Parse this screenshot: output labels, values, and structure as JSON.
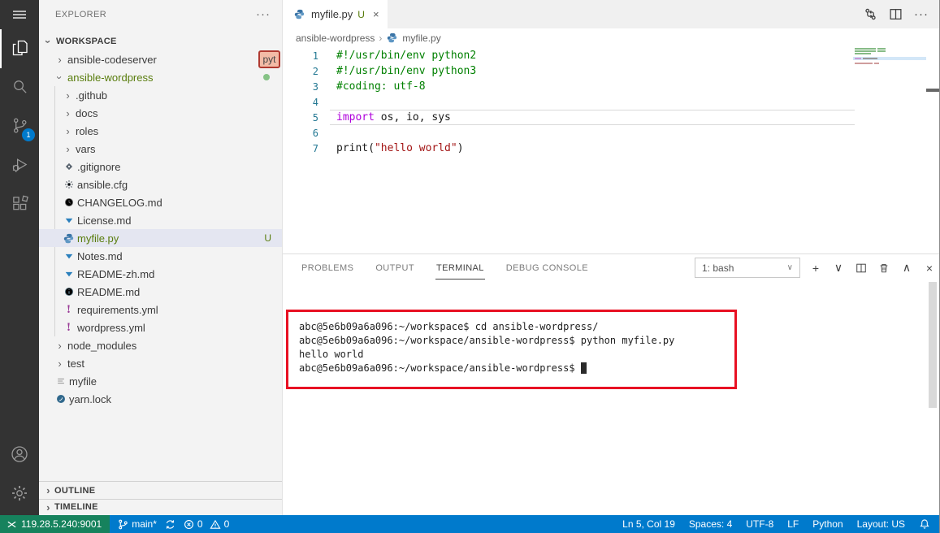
{
  "colors": {
    "accent_blue": "#007acc",
    "remote_green": "#16825d",
    "annotation_red": "#e81123",
    "untracked_green": "#587c0c",
    "selection_bg": "#e4e6f1",
    "activity_bar_bg": "#333333",
    "sidebar_bg": "#f3f3f3"
  },
  "activity_bar": {
    "items": [
      {
        "id": "menu",
        "icon": "menu-icon"
      },
      {
        "id": "explorer",
        "icon": "files-icon",
        "active": true
      },
      {
        "id": "search",
        "icon": "search-icon"
      },
      {
        "id": "source-control",
        "icon": "source-control-icon",
        "badge": "1"
      },
      {
        "id": "run-debug",
        "icon": "debug-icon"
      },
      {
        "id": "extensions",
        "icon": "extensions-icon"
      }
    ],
    "bottom_items": [
      {
        "id": "accounts",
        "icon": "account-icon"
      },
      {
        "id": "settings",
        "icon": "gear-icon"
      }
    ]
  },
  "sidebar": {
    "title": "EXPLORER",
    "more_label": "···",
    "root_label": "WORKSPACE",
    "hover_badge": "pyt",
    "tree": [
      {
        "label": "ansible-codeserver",
        "level": 1,
        "kind": "folder",
        "expanded": false
      },
      {
        "label": "ansible-wordpress",
        "level": 1,
        "kind": "folder",
        "expanded": true,
        "git": "untracked",
        "dot": true
      },
      {
        "label": ".github",
        "level": 2,
        "kind": "folder",
        "expanded": false
      },
      {
        "label": "docs",
        "level": 2,
        "kind": "folder",
        "expanded": false
      },
      {
        "label": "roles",
        "level": 2,
        "kind": "folder",
        "expanded": false
      },
      {
        "label": "vars",
        "level": 2,
        "kind": "folder",
        "expanded": false
      },
      {
        "label": ".gitignore",
        "level": 2,
        "kind": "file",
        "icon": "git-icon"
      },
      {
        "label": "ansible.cfg",
        "level": 2,
        "kind": "file",
        "icon": "gear-file-icon"
      },
      {
        "label": "CHANGELOG.md",
        "level": 2,
        "kind": "file",
        "icon": "clock-icon"
      },
      {
        "label": "License.md",
        "level": 2,
        "kind": "file",
        "icon": "markdown-down-icon"
      },
      {
        "label": "myfile.py",
        "level": 2,
        "kind": "file",
        "icon": "python-icon",
        "selected": true,
        "git": "untracked",
        "badge": "U"
      },
      {
        "label": "Notes.md",
        "level": 2,
        "kind": "file",
        "icon": "markdown-down-icon"
      },
      {
        "label": "README-zh.md",
        "level": 2,
        "kind": "file",
        "icon": "markdown-down-icon"
      },
      {
        "label": "README.md",
        "level": 2,
        "kind": "file",
        "icon": "info-icon"
      },
      {
        "label": "requirements.yml",
        "level": 2,
        "kind": "file",
        "icon": "exclamation-icon"
      },
      {
        "label": "wordpress.yml",
        "level": 2,
        "kind": "file",
        "icon": "exclamation-icon"
      },
      {
        "label": "node_modules",
        "level": 1,
        "kind": "folder",
        "expanded": false
      },
      {
        "label": "test",
        "level": 1,
        "kind": "folder",
        "expanded": false
      },
      {
        "label": "myfile",
        "level": 1,
        "kind": "file",
        "icon": "list-icon"
      },
      {
        "label": "yarn.lock",
        "level": 1,
        "kind": "file",
        "icon": "yarn-icon"
      }
    ],
    "bottom_sections": [
      {
        "label": "OUTLINE"
      },
      {
        "label": "TIMELINE"
      }
    ]
  },
  "editor": {
    "tab": {
      "label": "myfile.py",
      "git_badge": "U",
      "close_label": "×",
      "icon": "python-icon"
    },
    "actions": [
      {
        "id": "open-changes",
        "icon": "open-changes-icon"
      },
      {
        "id": "split-editor",
        "icon": "split-editor-icon"
      },
      {
        "id": "more-actions",
        "icon": "more-actions-icon"
      }
    ],
    "breadcrumbs": [
      {
        "label": "ansible-wordpress"
      },
      {
        "label": "myfile.py",
        "icon": "python-icon"
      }
    ],
    "code_lines": [
      {
        "n": "1",
        "tokens": [
          {
            "s": "comment",
            "t": "#!/usr/bin/env python2"
          }
        ]
      },
      {
        "n": "2",
        "tokens": [
          {
            "s": "comment",
            "t": "#!/usr/bin/env python3"
          }
        ]
      },
      {
        "n": "3",
        "tokens": [
          {
            "s": "comment",
            "t": "#coding: utf-8"
          }
        ]
      },
      {
        "n": "4",
        "tokens": []
      },
      {
        "n": "5",
        "current": true,
        "tokens": [
          {
            "s": "keyword",
            "t": "import"
          },
          {
            "s": "plain",
            "t": " os, io, sys"
          }
        ]
      },
      {
        "n": "6",
        "tokens": []
      },
      {
        "n": "7",
        "tokens": [
          {
            "s": "plain",
            "t": "print("
          },
          {
            "s": "string",
            "t": "\"hello world\""
          },
          {
            "s": "plain",
            "t": ")"
          }
        ]
      }
    ]
  },
  "panel": {
    "tabs": [
      {
        "label": "PROBLEMS"
      },
      {
        "label": "OUTPUT"
      },
      {
        "label": "TERMINAL",
        "active": true
      },
      {
        "label": "DEBUG CONSOLE"
      }
    ],
    "terminal_select": "1: bash",
    "icons": [
      {
        "id": "new-terminal",
        "glyph": "+"
      },
      {
        "id": "launch-profile-chevron",
        "glyph": "∨"
      },
      {
        "id": "split-terminal",
        "icon": "split-small-icon"
      },
      {
        "id": "kill-terminal",
        "icon": "trash-icon"
      },
      {
        "id": "maximize-panel",
        "glyph": "∧"
      },
      {
        "id": "close-panel",
        "glyph": "×"
      }
    ],
    "terminal_lines": [
      "abc@5e6b09a6a096:~/workspace$ cd ansible-wordpress/",
      "abc@5e6b09a6a096:~/workspace/ansible-wordpress$ python myfile.py",
      "hello world",
      "abc@5e6b09a6a096:~/workspace/ansible-wordpress$ "
    ]
  },
  "status_bar": {
    "remote_label": "119.28.5.240:9001",
    "branch_label": "main*",
    "error_count": "0",
    "warning_count": "0",
    "right_items": [
      "Ln 5, Col 19",
      "Spaces: 4",
      "UTF-8",
      "LF",
      "Python",
      "Layout: US"
    ]
  }
}
